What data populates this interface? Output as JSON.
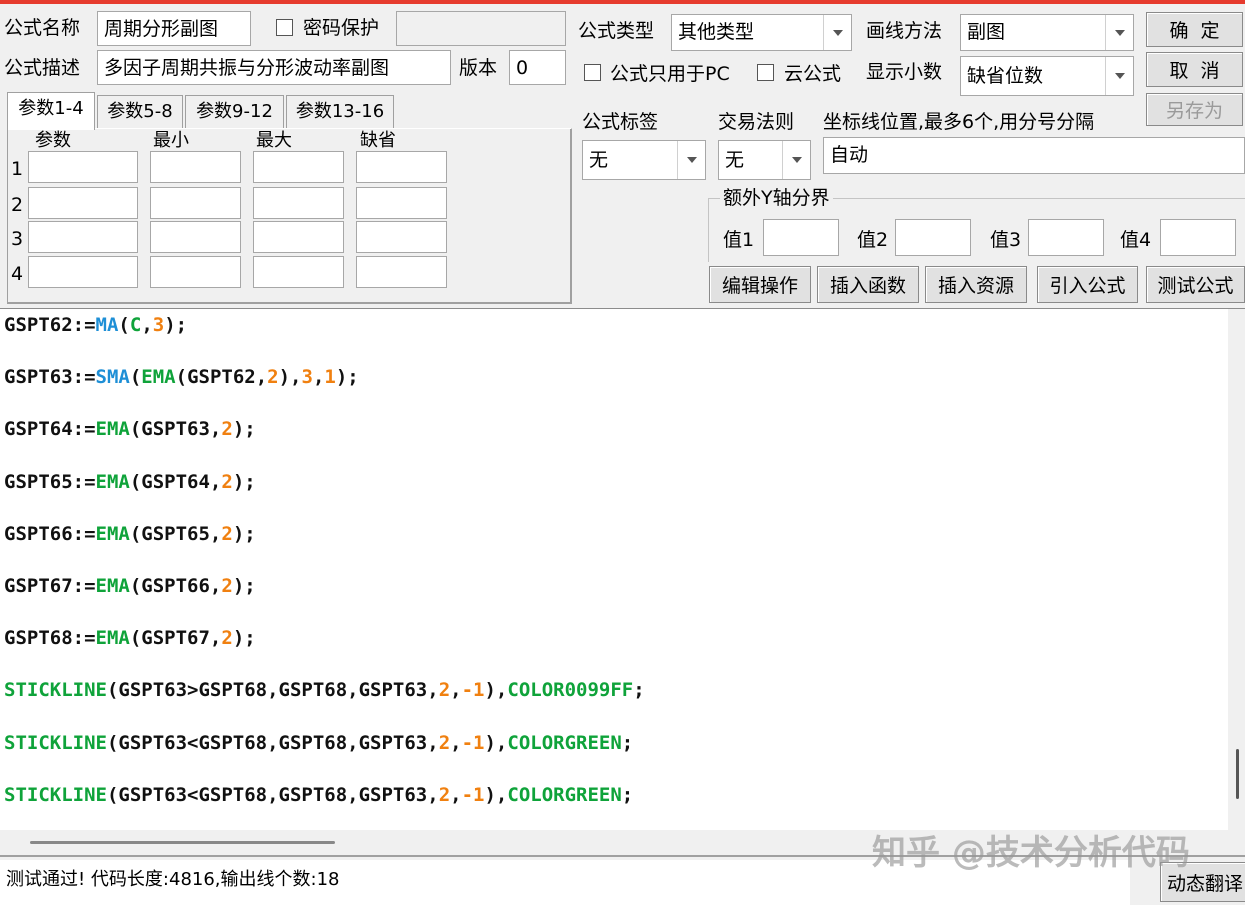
{
  "header": {
    "name_label": "公式名称",
    "name_value": "周期分形副图",
    "password_label": "密码保护",
    "password_value": "",
    "desc_label": "公式描述",
    "desc_value": "多因子周期共振与分形波动率副图",
    "version_label": "版本",
    "version_value": "0"
  },
  "options": {
    "type_label": "公式类型",
    "type_value": "其他类型",
    "draw_label": "画线方法",
    "draw_value": "副图",
    "pc_only_label": "公式只用于PC",
    "cloud_label": "云公式",
    "decimal_label": "显示小数",
    "decimal_value": "缺省位数",
    "tag_label": "公式标签",
    "tag_value": "无",
    "rule_label": "交易法则",
    "rule_value": "无",
    "coord_label": "坐标线位置,最多6个,用分号分隔",
    "coord_value": "自动",
    "extra_y_label": "额外Y轴分界",
    "values": [
      "值1",
      "值2",
      "值3",
      "值4"
    ]
  },
  "buttons": {
    "ok": "确  定",
    "cancel": "取  消",
    "save_as": "另存为",
    "edit": "编辑操作",
    "insert_func": "插入函数",
    "insert_res": "插入资源",
    "import": "引入公式",
    "test": "测试公式",
    "translate": "动态翻译"
  },
  "tabs": [
    "参数1-4",
    "参数5-8",
    "参数9-12",
    "参数13-16"
  ],
  "params": {
    "headers": [
      "参数",
      "最小",
      "最大",
      "缺省"
    ],
    "rows": [
      "1",
      "2",
      "3",
      "4"
    ]
  },
  "code": [
    [
      [
        "GSPT62:=",
        "black"
      ],
      [
        "MA",
        "blue"
      ],
      [
        "(",
        "black"
      ],
      [
        "C",
        "green"
      ],
      [
        ",",
        "black"
      ],
      [
        "3",
        "orange"
      ],
      [
        ");",
        "black"
      ]
    ],
    [
      [
        "GSPT63:=",
        "black"
      ],
      [
        "SMA",
        "blue"
      ],
      [
        "(",
        "black"
      ],
      [
        "EMA",
        "green"
      ],
      [
        "(GSPT62,",
        "black"
      ],
      [
        "2",
        "orange"
      ],
      [
        "),",
        "black"
      ],
      [
        "3",
        "orange"
      ],
      [
        ",",
        "black"
      ],
      [
        "1",
        "orange"
      ],
      [
        ");",
        "black"
      ]
    ],
    [
      [
        "GSPT64:=",
        "black"
      ],
      [
        "EMA",
        "green"
      ],
      [
        "(GSPT63,",
        "black"
      ],
      [
        "2",
        "orange"
      ],
      [
        ");",
        "black"
      ]
    ],
    [
      [
        "GSPT65:=",
        "black"
      ],
      [
        "EMA",
        "green"
      ],
      [
        "(GSPT64,",
        "black"
      ],
      [
        "2",
        "orange"
      ],
      [
        ");",
        "black"
      ]
    ],
    [
      [
        "GSPT66:=",
        "black"
      ],
      [
        "EMA",
        "green"
      ],
      [
        "(GSPT65,",
        "black"
      ],
      [
        "2",
        "orange"
      ],
      [
        ");",
        "black"
      ]
    ],
    [
      [
        "GSPT67:=",
        "black"
      ],
      [
        "EMA",
        "green"
      ],
      [
        "(GSPT66,",
        "black"
      ],
      [
        "2",
        "orange"
      ],
      [
        ");",
        "black"
      ]
    ],
    [
      [
        "GSPT68:=",
        "black"
      ],
      [
        "EMA",
        "green"
      ],
      [
        "(GSPT67,",
        "black"
      ],
      [
        "2",
        "orange"
      ],
      [
        ");",
        "black"
      ]
    ],
    [
      [
        "STICKLINE",
        "green"
      ],
      [
        "(GSPT63>GSPT68,GSPT68,GSPT63,",
        "black"
      ],
      [
        "2",
        "orange"
      ],
      [
        ",",
        "black"
      ],
      [
        "-1",
        "orange"
      ],
      [
        "),",
        "black"
      ],
      [
        "COLOR0099FF",
        "green"
      ],
      [
        ";",
        "black"
      ]
    ],
    [
      [
        "STICKLINE",
        "green"
      ],
      [
        "(GSPT63<GSPT68,GSPT68,GSPT63,",
        "black"
      ],
      [
        "2",
        "orange"
      ],
      [
        ",",
        "black"
      ],
      [
        "-1",
        "orange"
      ],
      [
        "),",
        "black"
      ],
      [
        "COLORGREEN",
        "green"
      ],
      [
        ";",
        "black"
      ]
    ],
    [
      [
        "STICKLINE",
        "green"
      ],
      [
        "(GSPT63<GSPT68,GSPT68,GSPT63,",
        "black"
      ],
      [
        "2",
        "orange"
      ],
      [
        ",",
        "black"
      ],
      [
        "-1",
        "orange"
      ],
      [
        "),",
        "black"
      ],
      [
        "COLORGREEN",
        "green"
      ],
      [
        ";",
        "black"
      ]
    ]
  ],
  "status": "测试通过! 代码长度:4816,输出线个数:18",
  "watermark": "知乎 @技术分析代码",
  "colors": {
    "black": "#111111",
    "blue": "#1e8fd6",
    "green": "#0fa33a",
    "orange": "#f08010"
  }
}
